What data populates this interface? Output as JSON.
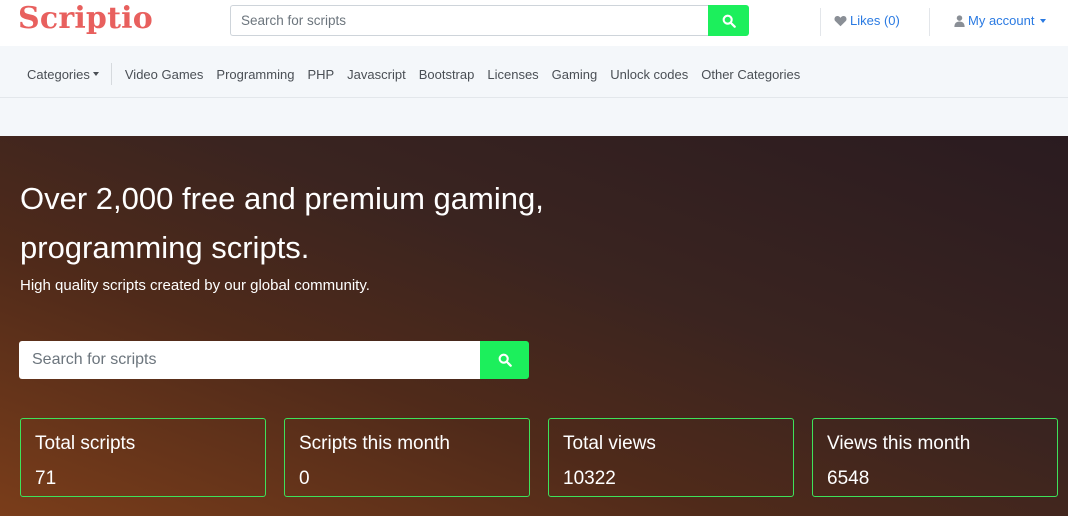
{
  "brand": {
    "logo": "Scriptio",
    "accent_color": "#e8605e"
  },
  "header": {
    "search": {
      "placeholder": "Search for scripts",
      "button_icon": "search-icon"
    },
    "likes": {
      "icon": "heart-icon",
      "label": "Likes (0)"
    },
    "account": {
      "icon": "user-icon",
      "label": "My account"
    }
  },
  "categories": {
    "dropdown_label": "Categories",
    "items": [
      "Video Games",
      "Programming",
      "PHP",
      "Javascript",
      "Bootstrap",
      "Licenses",
      "Gaming",
      "Unlock codes",
      "Other Categories"
    ]
  },
  "hero": {
    "title": "Over 2,000 free and premium gaming, programming scripts.",
    "subtitle": "High quality scripts created by our global community.",
    "search": {
      "placeholder": "Search for scripts",
      "button_icon": "search-icon",
      "button_color": "#1cef5c"
    },
    "stats": [
      {
        "label": "Total scripts",
        "value": "71"
      },
      {
        "label": "Scripts this month",
        "value": "0"
      },
      {
        "label": "Total views",
        "value": "10322"
      },
      {
        "label": "Views this month",
        "value": "6548"
      }
    ]
  }
}
